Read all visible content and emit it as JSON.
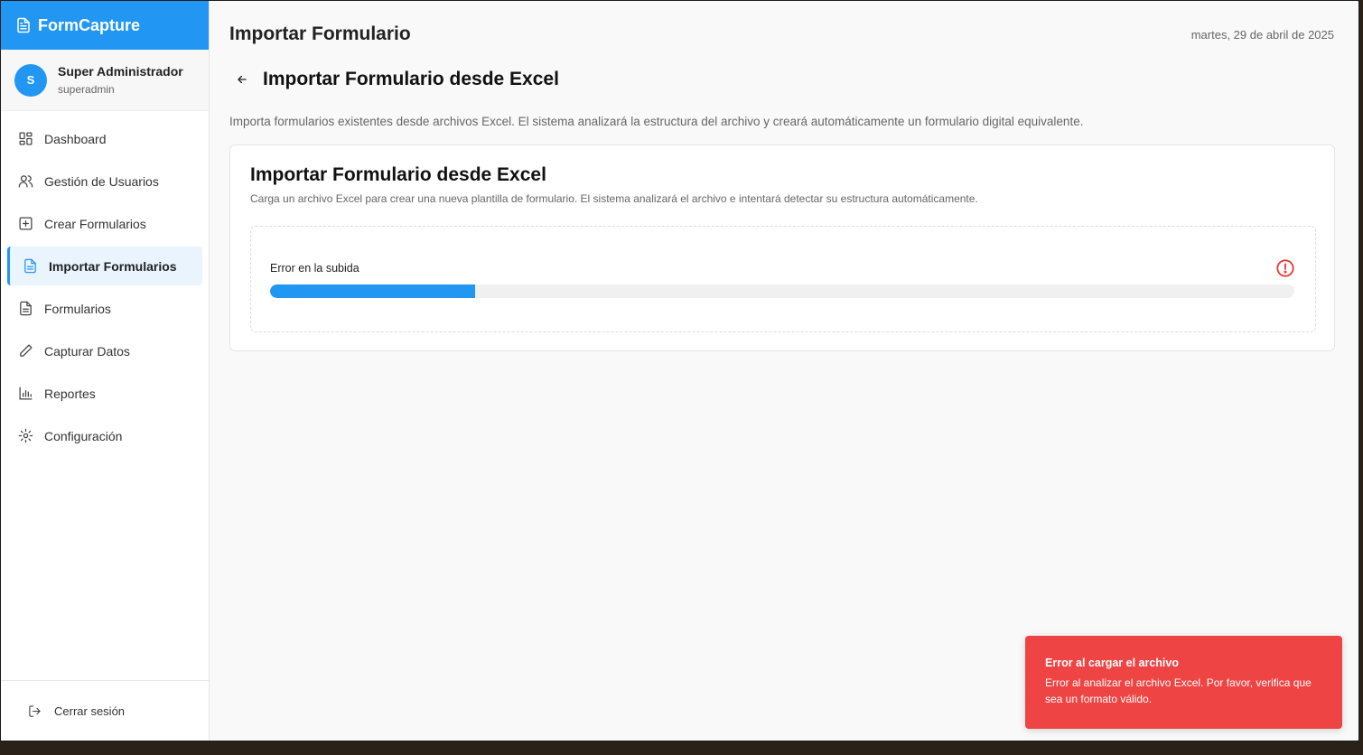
{
  "brand": {
    "name": "FormCapture"
  },
  "user": {
    "initial": "S",
    "name": "Super Administrador",
    "handle": "superadmin"
  },
  "nav": {
    "items": [
      {
        "label": "Dashboard"
      },
      {
        "label": "Gestión de Usuarios"
      },
      {
        "label": "Crear Formularios"
      },
      {
        "label": "Importar Formularios",
        "active": true
      },
      {
        "label": "Formularios"
      },
      {
        "label": "Capturar Datos"
      },
      {
        "label": "Reportes"
      },
      {
        "label": "Configuración"
      }
    ],
    "logout_label": "Cerrar sesión"
  },
  "header": {
    "title": "Importar Formulario",
    "date": "martes, 29 de abril de 2025"
  },
  "page": {
    "subtitle": "Importar Formulario desde Excel",
    "intro": "Importa formularios existentes desde archivos Excel. El sistema analizará la estructura del archivo y creará automáticamente un formulario digital equivalente."
  },
  "card": {
    "title": "Importar Formulario desde Excel",
    "description": "Carga un archivo Excel para crear una nueva plantilla de formulario. El sistema analizará el archivo e intentará detectar su estructura automáticamente.",
    "upload": {
      "status": "Error en la subida",
      "progress": 0.2
    }
  },
  "toast": {
    "title": "Error al cargar el archivo",
    "message": "Error al analizar el archivo Excel. Por favor, verifica que sea un formato válido."
  },
  "colors": {
    "accent": "#2196f3",
    "error": "#ef4444"
  },
  "icons": [
    "document-icon",
    "dashboard-icon",
    "users-icon",
    "plus-square-icon",
    "file-icon",
    "pencil-icon",
    "bar-chart-icon",
    "gear-icon",
    "logout-icon",
    "arrow-left-icon",
    "alert-circle-icon"
  ]
}
